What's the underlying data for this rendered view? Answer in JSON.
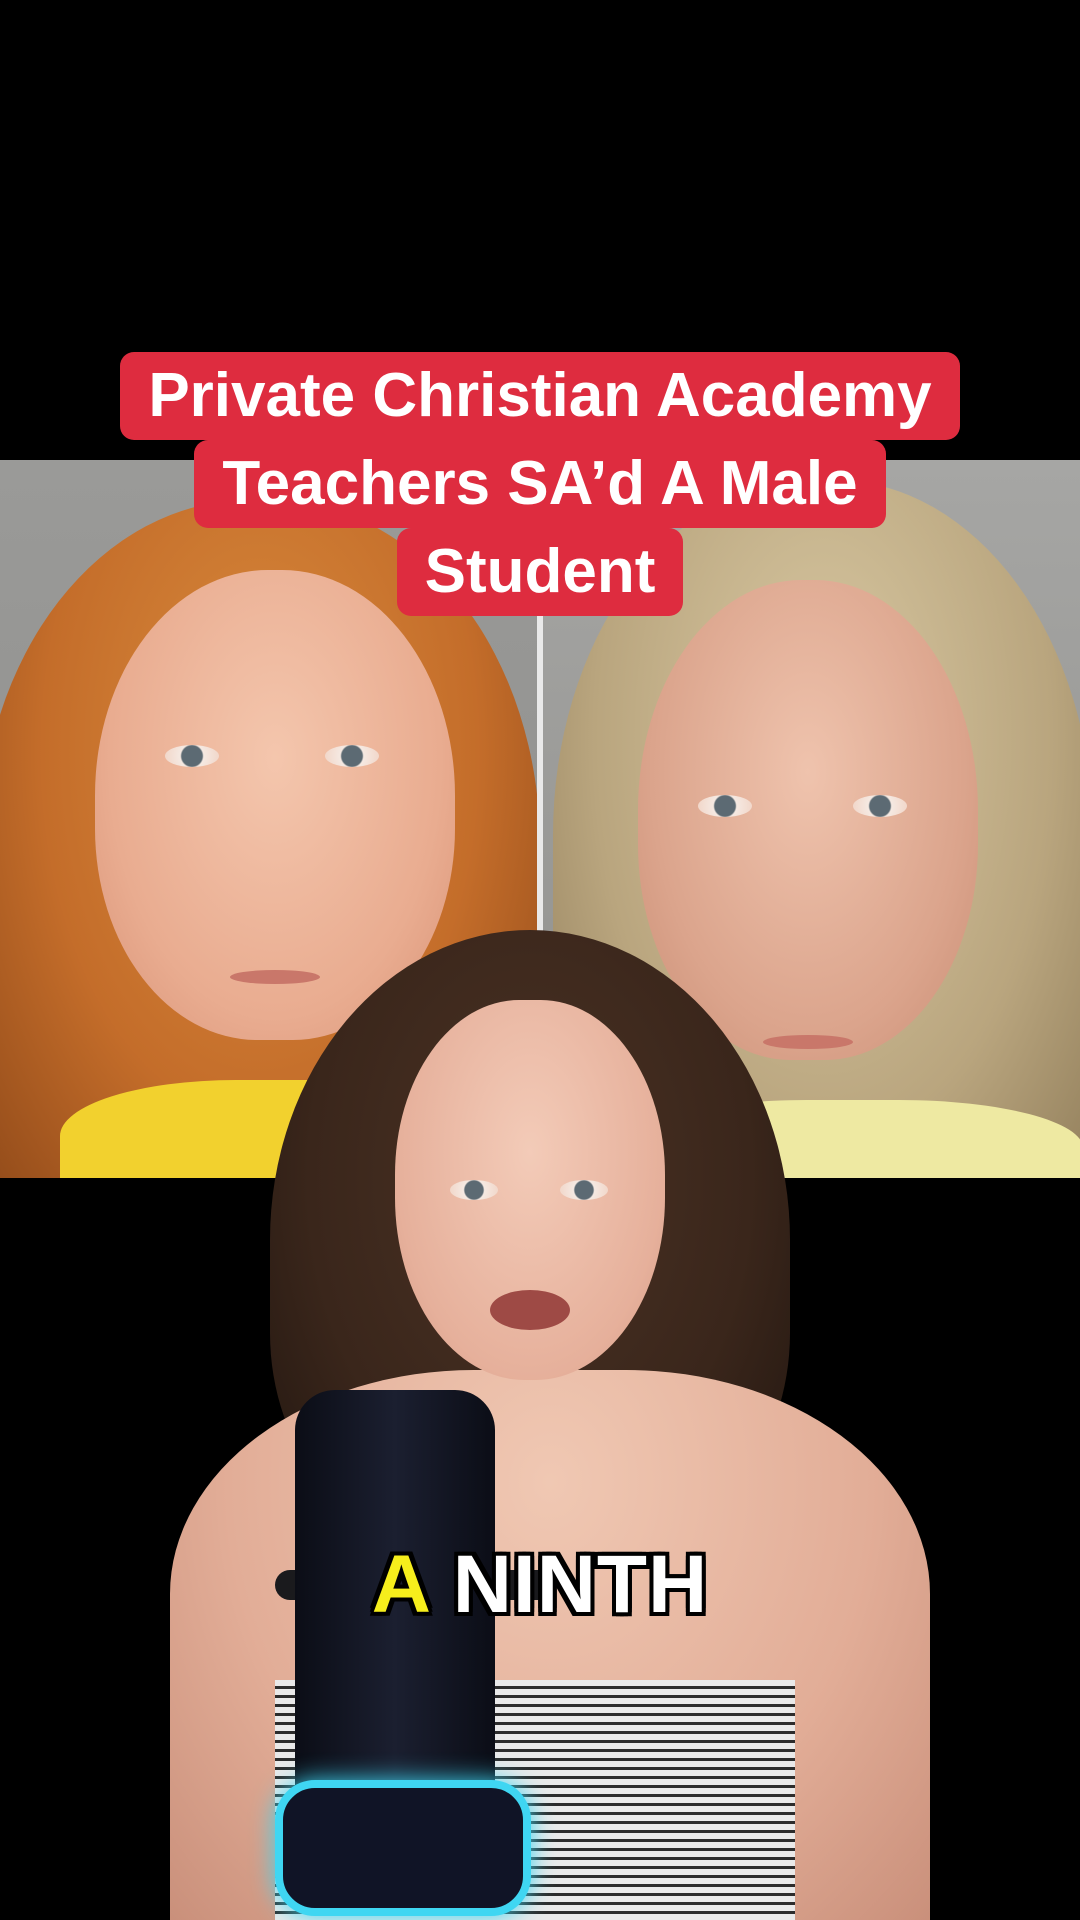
{
  "title": {
    "lines": [
      "Private Christian Academy",
      "Teachers SA’d A Male",
      "Student"
    ]
  },
  "caption": {
    "highlight_word": "A",
    "rest": "NINTH"
  },
  "colors": {
    "banner_bg": "#de2c3f",
    "banner_text": "#ffffff",
    "caption_highlight": "#f6ee1c",
    "caption_text": "#ffffff",
    "mic_glow": "#3fd6f2"
  }
}
